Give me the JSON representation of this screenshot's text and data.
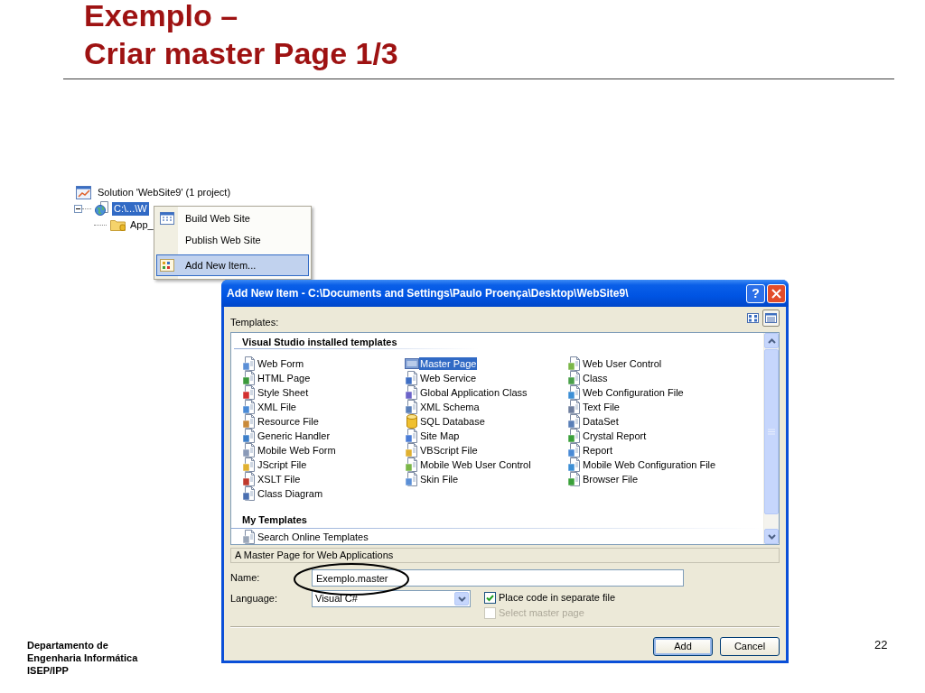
{
  "slide": {
    "title_lines": [
      "Exemplo –",
      "Criar master Page 1/3"
    ],
    "footer_lines": [
      "Departamento de",
      "Engenharia Informática",
      "ISEP/IPP"
    ],
    "page_number": "22"
  },
  "solution_explorer": {
    "items": [
      {
        "kind": "solution",
        "label": "Solution 'WebSite9' (1 project)",
        "selected": false,
        "children": [
          {
            "kind": "website",
            "label": "C:\\...\\W",
            "selected": true,
            "expanded": true,
            "children": [
              {
                "kind": "folder",
                "label": "App_",
                "selected": false
              }
            ]
          }
        ]
      }
    ]
  },
  "context_menu": {
    "items": [
      {
        "kind": "build",
        "label": "Build Web Site",
        "selected": false
      },
      {
        "kind": "plain",
        "label": "Publish Web Site",
        "selected": false
      },
      {
        "kind": "add",
        "label": "Add New Item...",
        "selected": true
      }
    ]
  },
  "dialog": {
    "title": "Add New Item - C:\\Documents and Settings\\Paulo Proença\\Desktop\\WebSite9\\",
    "help_button": "?",
    "templates_label": "Templates:",
    "view_buttons": [
      {
        "kind": "large_icons",
        "selected": false
      },
      {
        "kind": "small_icons",
        "selected": true
      }
    ],
    "groups": [
      {
        "heading": "Visual Studio installed templates",
        "items": [
          {
            "kind": "form",
            "label": "Web Form",
            "selected": false
          },
          {
            "kind": "master",
            "label": "Master Page",
            "selected": true
          },
          {
            "kind": "control",
            "label": "Web User Control",
            "selected": false
          },
          {
            "kind": "html",
            "label": "HTML Page",
            "selected": false
          },
          {
            "kind": "service",
            "label": "Web Service",
            "selected": false
          },
          {
            "kind": "class",
            "label": "Class",
            "selected": false
          },
          {
            "kind": "style",
            "label": "Style Sheet",
            "selected": false
          },
          {
            "kind": "global",
            "label": "Global Application Class",
            "selected": false
          },
          {
            "kind": "config",
            "label": "Web Configuration File",
            "selected": false
          },
          {
            "kind": "xml",
            "label": "XML File",
            "selected": false
          },
          {
            "kind": "schema",
            "label": "XML Schema",
            "selected": false
          },
          {
            "kind": "text",
            "label": "Text File",
            "selected": false
          },
          {
            "kind": "resource",
            "label": "Resource File",
            "selected": false
          },
          {
            "kind": "database",
            "label": "SQL Database",
            "selected": false
          },
          {
            "kind": "dataset",
            "label": "DataSet",
            "selected": false
          },
          {
            "kind": "handler",
            "label": "Generic Handler",
            "selected": false
          },
          {
            "kind": "sitemap",
            "label": "Site Map",
            "selected": false
          },
          {
            "kind": "crystal",
            "label": "Crystal Report",
            "selected": false
          },
          {
            "kind": "mobile_form",
            "label": "Mobile Web Form",
            "selected": false
          },
          {
            "kind": "vbscript",
            "label": "VBScript File",
            "selected": false
          },
          {
            "kind": "report",
            "label": "Report",
            "selected": false
          },
          {
            "kind": "jscript",
            "label": "JScript File",
            "selected": false
          },
          {
            "kind": "mobile_control",
            "label": "Mobile Web User Control",
            "selected": false
          },
          {
            "kind": "mobile_config",
            "label": "Mobile Web Configuration File",
            "selected": false
          },
          {
            "kind": "xslt",
            "label": "XSLT File",
            "selected": false
          },
          {
            "kind": "skin",
            "label": "Skin File",
            "selected": false
          },
          {
            "kind": "browser",
            "label": "Browser File",
            "selected": false
          },
          {
            "kind": "diagram",
            "label": "Class Diagram",
            "selected": false
          }
        ]
      },
      {
        "heading": "My Templates",
        "items": [
          {
            "kind": "search",
            "label": "Search Online Templates",
            "selected": false
          }
        ]
      }
    ],
    "description": "A Master Page for Web Applications",
    "name_field": {
      "label": "Name:",
      "value": "Exemplo.master"
    },
    "language_field": {
      "label": "Language:",
      "value": "Visual C#"
    },
    "options": [
      {
        "label": "Place code in separate file",
        "checked": true,
        "disabled": false
      },
      {
        "label": "Select master page",
        "checked": false,
        "disabled": true
      }
    ],
    "buttons": [
      {
        "label": "Add",
        "default": true
      },
      {
        "label": "Cancel",
        "default": false
      }
    ]
  }
}
